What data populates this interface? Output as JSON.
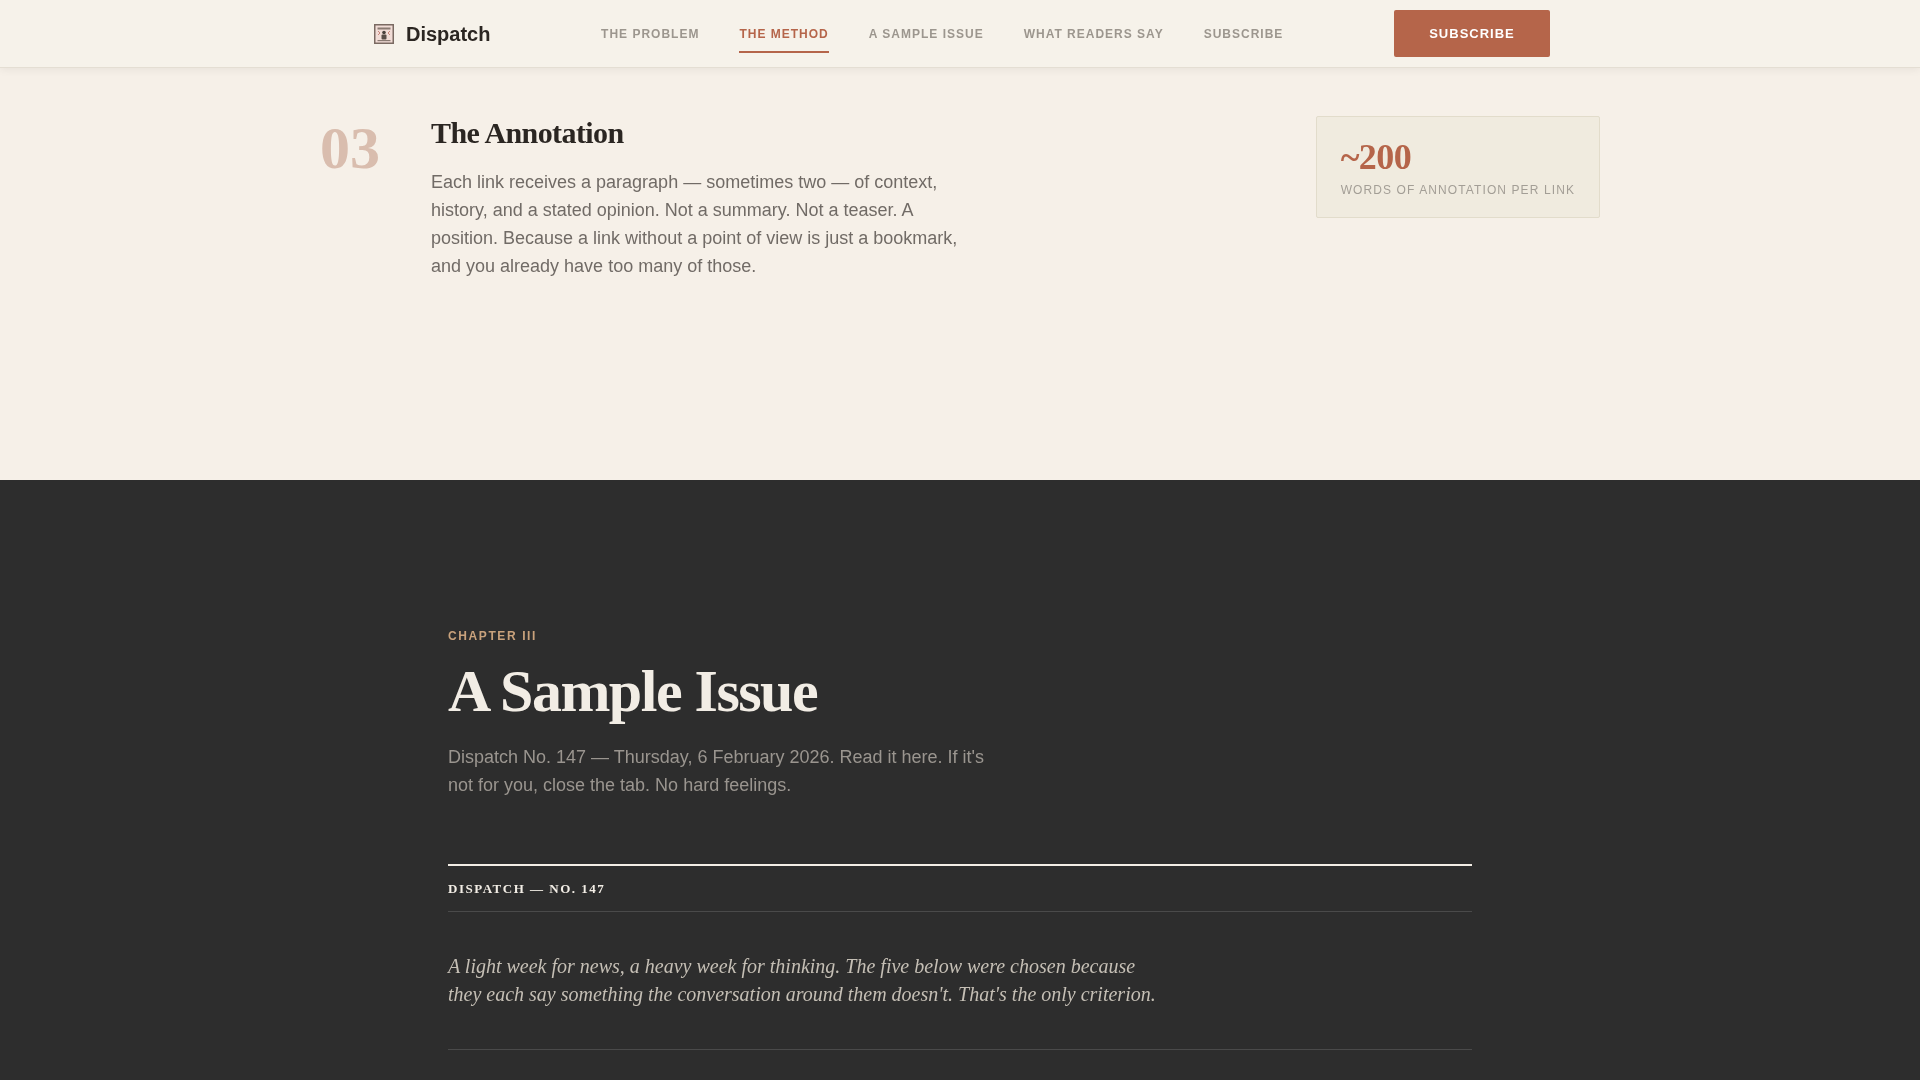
{
  "header": {
    "brand": "Dispatch",
    "nav": [
      {
        "label": "THE PROBLEM",
        "selected": false
      },
      {
        "label": "THE METHOD",
        "selected": true
      },
      {
        "label": "A SAMPLE ISSUE",
        "selected": false
      },
      {
        "label": "WHAT READERS SAY",
        "selected": false
      },
      {
        "label": "SUBSCRIBE",
        "selected": false
      }
    ],
    "button": "SUBSCRIBE"
  },
  "method_step": {
    "number": "03",
    "title": "The Annotation",
    "body": "Each link receives a paragraph — sometimes two — of context, history, and a stated opinion. Not a summary. Not a teaser. A position. Because a link without a point of view is just a bookmark, and you already have too many of those.",
    "stat": {
      "value": "~200",
      "label": "WORDS OF ANNOTATION PER LINK"
    }
  },
  "chapter": {
    "eyebrow": "CHAPTER III",
    "title": "A Sample Issue",
    "intro": "Dispatch No. 147 — Thursday, 6 February 2026. Read it here. If it's not for you, close the tab. No hard feelings.",
    "issue": {
      "masthead": "DISPATCH — NO. 147",
      "lede": "A light week for news, a heavy week for thinking. The five below were chosen because they each say something the conversation around them doesn't. That's the only criterion."
    }
  }
}
